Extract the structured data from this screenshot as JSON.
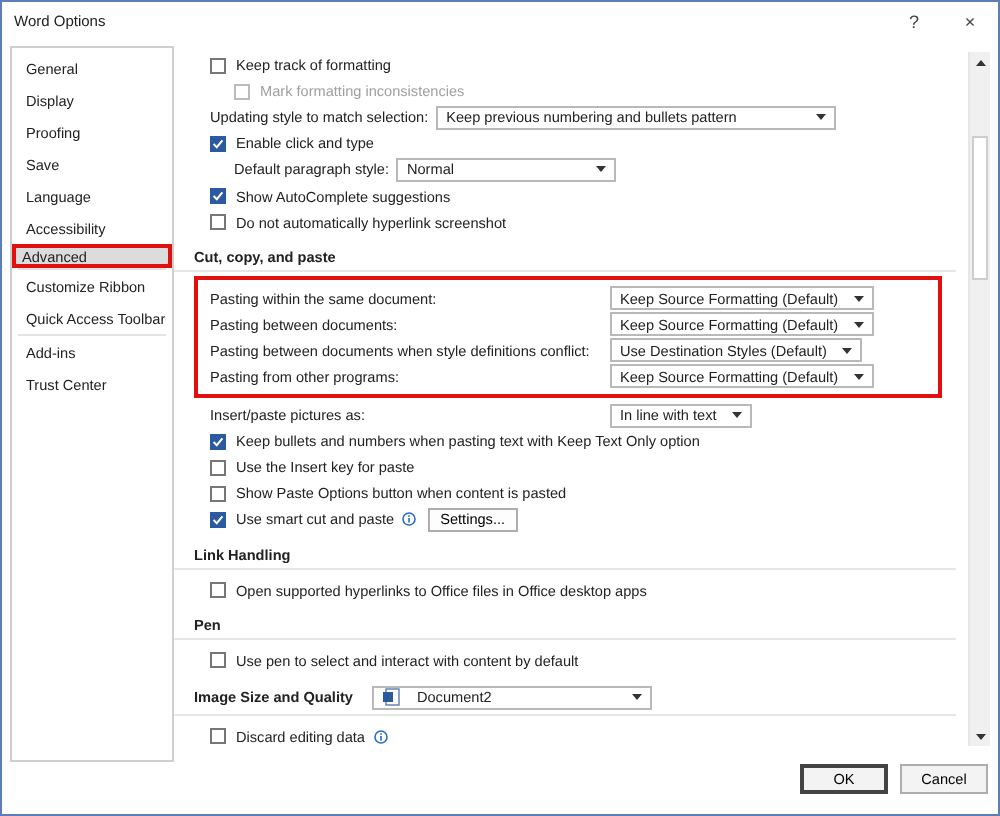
{
  "window": {
    "title": "Word Options",
    "help": "?",
    "close": "×"
  },
  "sidebar": {
    "groups": [
      [
        {
          "label": "General",
          "selected": false,
          "highlighted": false
        },
        {
          "label": "Display",
          "selected": false,
          "highlighted": false
        },
        {
          "label": "Proofing",
          "selected": false,
          "highlighted": false
        },
        {
          "label": "Save",
          "selected": false,
          "highlighted": false
        },
        {
          "label": "Language",
          "selected": false,
          "highlighted": false
        },
        {
          "label": "Accessibility",
          "selected": false,
          "highlighted": false
        },
        {
          "label": "Advanced",
          "selected": true,
          "highlighted": true
        }
      ],
      [
        {
          "label": "Customize Ribbon",
          "selected": false,
          "highlighted": false
        },
        {
          "label": "Quick Access Toolbar",
          "selected": false,
          "highlighted": false
        }
      ],
      [
        {
          "label": "Add-ins",
          "selected": false,
          "highlighted": false
        },
        {
          "label": "Trust Center",
          "selected": false,
          "highlighted": false
        }
      ]
    ]
  },
  "sections": [
    {
      "groups": [
        {
          "highlighted": false,
          "rows": [
            {
              "kind": "checkbox",
              "label": "Keep track of formatting",
              "checked": false,
              "disabled": false,
              "children": [
                {
                  "kind": "checkbox",
                  "label": "Mark formatting inconsistencies",
                  "checked": false,
                  "disabled": true
                }
              ]
            },
            {
              "kind": "select",
              "label": "Updating style to match selection:",
              "value": "Keep previous numbering and bullets pattern"
            },
            {
              "kind": "checkbox",
              "label": "Enable click and type",
              "checked": true,
              "disabled": false,
              "children": [
                {
                  "kind": "select",
                  "label": "Default paragraph style:",
                  "value": "Normal"
                }
              ]
            },
            {
              "kind": "checkbox",
              "label": "Show AutoComplete suggestions",
              "checked": true,
              "disabled": false
            },
            {
              "kind": "checkbox",
              "label": "Do not automatically hyperlink screenshot",
              "checked": false,
              "disabled": false
            }
          ]
        }
      ]
    },
    {
      "heading": "Cut, copy, and paste",
      "groups": [
        {
          "highlighted": true,
          "rows": [
            {
              "kind": "select",
              "label": "Pasting within the same document:",
              "value": "Keep Source Formatting (Default)"
            },
            {
              "kind": "select",
              "label": "Pasting between documents:",
              "value": "Keep Source Formatting (Default)"
            },
            {
              "kind": "select",
              "label": "Pasting between documents when style definitions conflict:",
              "value": "Use Destination Styles (Default)"
            },
            {
              "kind": "select",
              "label": "Pasting from other programs:",
              "value": "Keep Source Formatting (Default)"
            }
          ]
        },
        {
          "highlighted": false,
          "rows": [
            {
              "kind": "select",
              "label": "Insert/paste pictures as:",
              "value": "In line with text"
            },
            {
              "kind": "checkbox",
              "label": "Keep bullets and numbers when pasting text with Keep Text Only option",
              "checked": true,
              "disabled": false
            },
            {
              "kind": "checkbox",
              "label": "Use the Insert key for paste",
              "checked": false,
              "disabled": false
            },
            {
              "kind": "checkbox",
              "label": "Show Paste Options button when content is pasted",
              "checked": false,
              "disabled": false
            },
            {
              "kind": "checkbox",
              "label": "Use smart cut and paste",
              "checked": true,
              "disabled": false,
              "info": true,
              "button": "Settings..."
            }
          ]
        }
      ]
    },
    {
      "heading": "Link Handling",
      "groups": [
        {
          "highlighted": false,
          "rows": [
            {
              "kind": "checkbox",
              "label": "Open supported hyperlinks to Office files in Office desktop apps",
              "checked": false,
              "disabled": false
            }
          ]
        }
      ]
    },
    {
      "heading": "Pen",
      "groups": [
        {
          "highlighted": false,
          "rows": [
            {
              "kind": "checkbox",
              "label": "Use pen to select and interact with content by default",
              "checked": false,
              "disabled": false
            }
          ]
        }
      ]
    },
    {
      "heading": "Image Size and Quality",
      "select": "Document2",
      "groups": [
        {
          "highlighted": false,
          "rows": [
            {
              "kind": "checkbox",
              "label": "Discard editing data",
              "checked": false,
              "disabled": false,
              "info": true
            }
          ]
        }
      ]
    }
  ],
  "buttons": [
    {
      "label": "OK",
      "default": true
    },
    {
      "label": "Cancel",
      "default": false
    }
  ]
}
